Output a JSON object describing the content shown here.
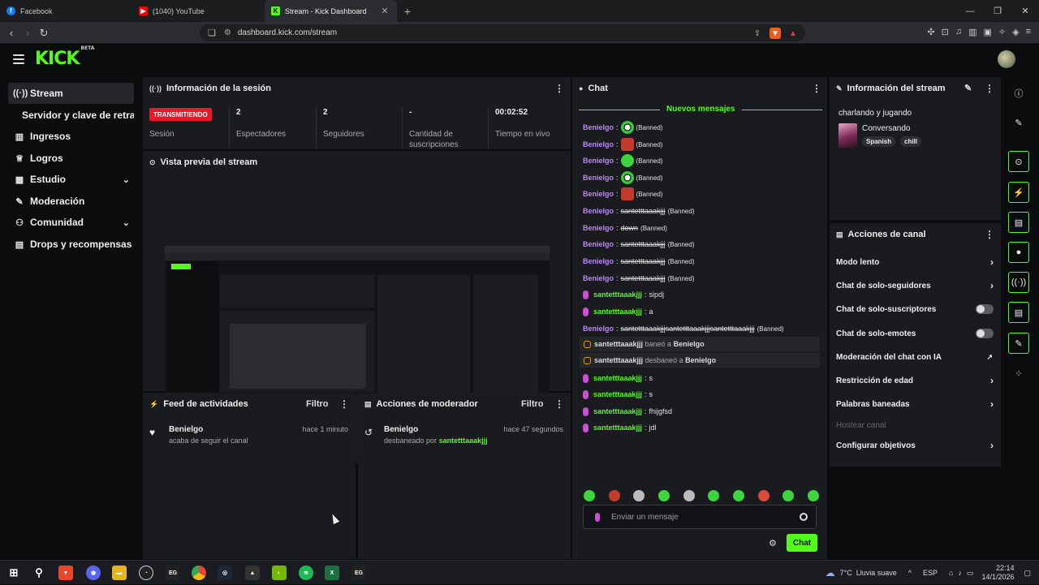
{
  "browser": {
    "tabs": [
      {
        "label": "Facebook",
        "fav_color": "#1877f2",
        "fav_icon": "facebook-icon"
      },
      {
        "label": "(1040) YouTube",
        "fav_color": "#ff0000",
        "fav_icon": "youtube-icon"
      },
      {
        "label": "Stream - Kick Dashboard",
        "fav_color": "#53fc18",
        "fav_icon": "kick-icon",
        "active": true
      }
    ],
    "url": "dashboard.kick.com/stream"
  },
  "app": {
    "logo": "KICK",
    "logo_badge": "BETA"
  },
  "sidebar": {
    "items": [
      {
        "label": "Stream",
        "icon": "broadcast-icon",
        "active": true
      },
      {
        "label": "Servidor y clave de retransmisión",
        "icon": ""
      },
      {
        "label": "Ingresos",
        "icon": "chart-icon"
      },
      {
        "label": "Logros",
        "icon": "trophy-icon"
      },
      {
        "label": "Estudio",
        "icon": "studio-icon",
        "expandable": true
      },
      {
        "label": "Moderación",
        "icon": "wrench-icon"
      },
      {
        "label": "Comunidad",
        "icon": "people-icon",
        "expandable": true
      },
      {
        "label": "Drops y recompensas",
        "icon": "gift-icon"
      }
    ]
  },
  "session": {
    "title": "Información de la sesión",
    "status_badge": "TRANSMITIENDO",
    "status_label": "Sesión",
    "stats": [
      {
        "value": "2",
        "label": "Espectadores"
      },
      {
        "value": "2",
        "label": "Seguidores"
      },
      {
        "value": "-",
        "label": "Cantidad de suscripciones"
      },
      {
        "value": "00:02:52",
        "label": "Tiempo en vivo"
      }
    ]
  },
  "preview": {
    "title": "Vista previa del stream"
  },
  "feed": {
    "title": "Feed de actividades",
    "filter": "Filtro",
    "items": [
      {
        "user": "Benielgo",
        "desc": "acaba de seguir el canal",
        "time": "hace 1 minuto",
        "icon": "heart-icon"
      }
    ]
  },
  "modactions": {
    "title": "Acciones de moderador",
    "filter": "Filtro",
    "items": [
      {
        "user": "Benielgo",
        "desc": "desbaneado por ",
        "by": "santetttaaakjjj",
        "time": "hace 47 segundos",
        "icon": "undo-icon"
      }
    ]
  },
  "chat": {
    "title": "Chat",
    "new_messages": "Nuevos mensajes",
    "messages": [
      {
        "user": "Benielgo",
        "emote": "c",
        "tag": "(Banned)"
      },
      {
        "user": "Benielgo",
        "emote": "r",
        "tag": "(Banned)"
      },
      {
        "user": "Benielgo",
        "emote": "g",
        "tag": "(Banned)"
      },
      {
        "user": "Benielgo",
        "emote": "c",
        "tag": "(Banned)"
      },
      {
        "user": "Benielgo",
        "emote": "r",
        "tag": "(Banned)"
      },
      {
        "user": "Benielgo",
        "struck": "santetttaaakjjj",
        "tag": "(Banned)"
      },
      {
        "user": "Benielgo",
        "struck": "down",
        "tag": "(Banned)"
      },
      {
        "user": "Benielgo",
        "struck": "santetttaaakjjj",
        "tag": "(Banned)"
      },
      {
        "user": "Benielgo",
        "struck": "santetttaaakjjj",
        "tag": "(Banned)"
      },
      {
        "user": "Benielgo",
        "struck": "santetttaaakjjj",
        "tag": "(Banned)"
      },
      {
        "user": "santetttaaakjjj",
        "text": "sipdj",
        "mod": true
      },
      {
        "user": "santetttaaakjjj",
        "text": "a",
        "mod": true
      },
      {
        "user": "Benielgo",
        "struck": "santetttaaakjjjsantetttaaakjjjsantetttaaakjjj",
        "tag": "(Banned)"
      }
    ],
    "system": [
      {
        "actor": "santetttaaakjjj",
        "action": " baneó a ",
        "target": "Benielgo"
      },
      {
        "actor": "santetttaaakjjj",
        "action": " desbaneó a ",
        "target": "Benielgo"
      }
    ],
    "messages2": [
      {
        "user": "santetttaaakjjj",
        "text": "s"
      },
      {
        "user": "santetttaaakjjj",
        "text": "s"
      },
      {
        "user": "santetttaaakjjj",
        "text": "fhijgfsd"
      },
      {
        "user": "santetttaaakjjj",
        "text": "jdl"
      }
    ],
    "input_placeholder": "Enviar un mensaje",
    "send_label": "Chat",
    "emote_colors": [
      "#3dd43d",
      "#c43b2b",
      "#bbbbbb",
      "#3dd43d",
      "#bbbbbb",
      "#3dd43d",
      "#3dd43d",
      "#d94a3a",
      "#3dd43d",
      "#3dd43d"
    ]
  },
  "stream_info": {
    "title": "Información del stream",
    "stream_title": "charlando y jugando",
    "category": "Conversando",
    "tags": [
      "Spanish",
      "chill"
    ]
  },
  "channel_actions": {
    "title": "Acciones de canal",
    "items": [
      {
        "label": "Modo lento",
        "kind": "arrow"
      },
      {
        "label": "Chat de solo-seguidores",
        "kind": "arrow"
      },
      {
        "label": "Chat de solo-suscriptores",
        "kind": "toggle"
      },
      {
        "label": "Chat de solo-emotes",
        "kind": "toggle"
      },
      {
        "label": "Moderación del chat con IA",
        "kind": "external"
      },
      {
        "label": "Restricción de edad",
        "kind": "arrow"
      },
      {
        "label": "Palabras baneadas",
        "kind": "arrow"
      },
      {
        "label": "Hostear canal",
        "kind": "disabled"
      },
      {
        "label": "Configurar objetivos",
        "kind": "arrow"
      }
    ]
  },
  "taskbar": {
    "weather": "7°C  Lluvia suave",
    "lang": "ESP",
    "time": "22:14",
    "date": "14/1/2026",
    "icons": [
      "brave-icon",
      "discord-icon",
      "folder-icon",
      "obs-icon",
      "epic-games-icon",
      "chrome-icon",
      "steam-icon",
      "game-icon",
      "nvidia-icon",
      "spotify-icon",
      "excel-icon",
      "epic-games-icon-2"
    ]
  }
}
